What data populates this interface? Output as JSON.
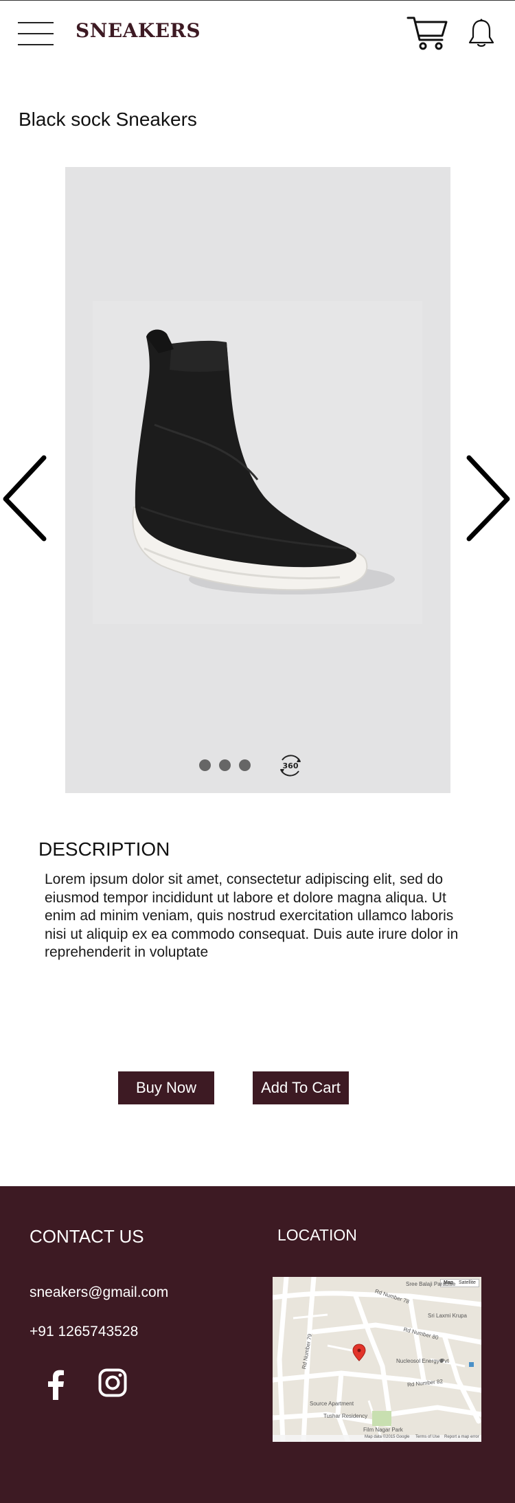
{
  "header": {
    "brand": "SNEAKERS",
    "menu_icon": "hamburger-menu-icon",
    "cart_icon": "shopping-cart-icon",
    "bell_icon": "notification-bell-icon"
  },
  "product": {
    "title": "Black sock Sneakers",
    "gallery": {
      "image_count": 3,
      "view_360_label": "360"
    }
  },
  "description": {
    "heading": "DESCRIPTION",
    "body": "Lorem ipsum dolor sit amet, consectetur adipiscing elit, sed do eiusmod tempor incididunt ut labore et dolore magna aliqua. Ut enim ad minim veniam, quis nostrud exercitation ullamco laboris nisi ut aliquip ex ea commodo consequat. Duis aute irure dolor in reprehenderit in voluptate"
  },
  "actions": {
    "buy_now": "Buy Now",
    "add_to_cart": "Add To Cart"
  },
  "footer": {
    "contact_heading": "CONTACT US",
    "email": "sneakers@gmail.com",
    "phone": "+91 1265743528",
    "location_heading": "LOCATION",
    "social": [
      "facebook-icon",
      "instagram-icon"
    ],
    "map": {
      "toggle_map": "Map",
      "toggle_satellite": "Satellite",
      "labels": [
        "Sree Balaji Paradise",
        "Rd Number 78",
        "Sri Laxmi Krupa",
        "Rd Number 80",
        "Nucleosol Energy Pvt",
        "Rd Number 82",
        "Rd Number 79",
        "Source Apartment",
        "Tushar Residency",
        "Film Nagar Park",
        "Map data ©2015 Google",
        "Terms of Use",
        "Report a map error"
      ]
    }
  },
  "colors": {
    "brand": "#3d1a23",
    "gallery_bg": "#e3e3e4"
  }
}
